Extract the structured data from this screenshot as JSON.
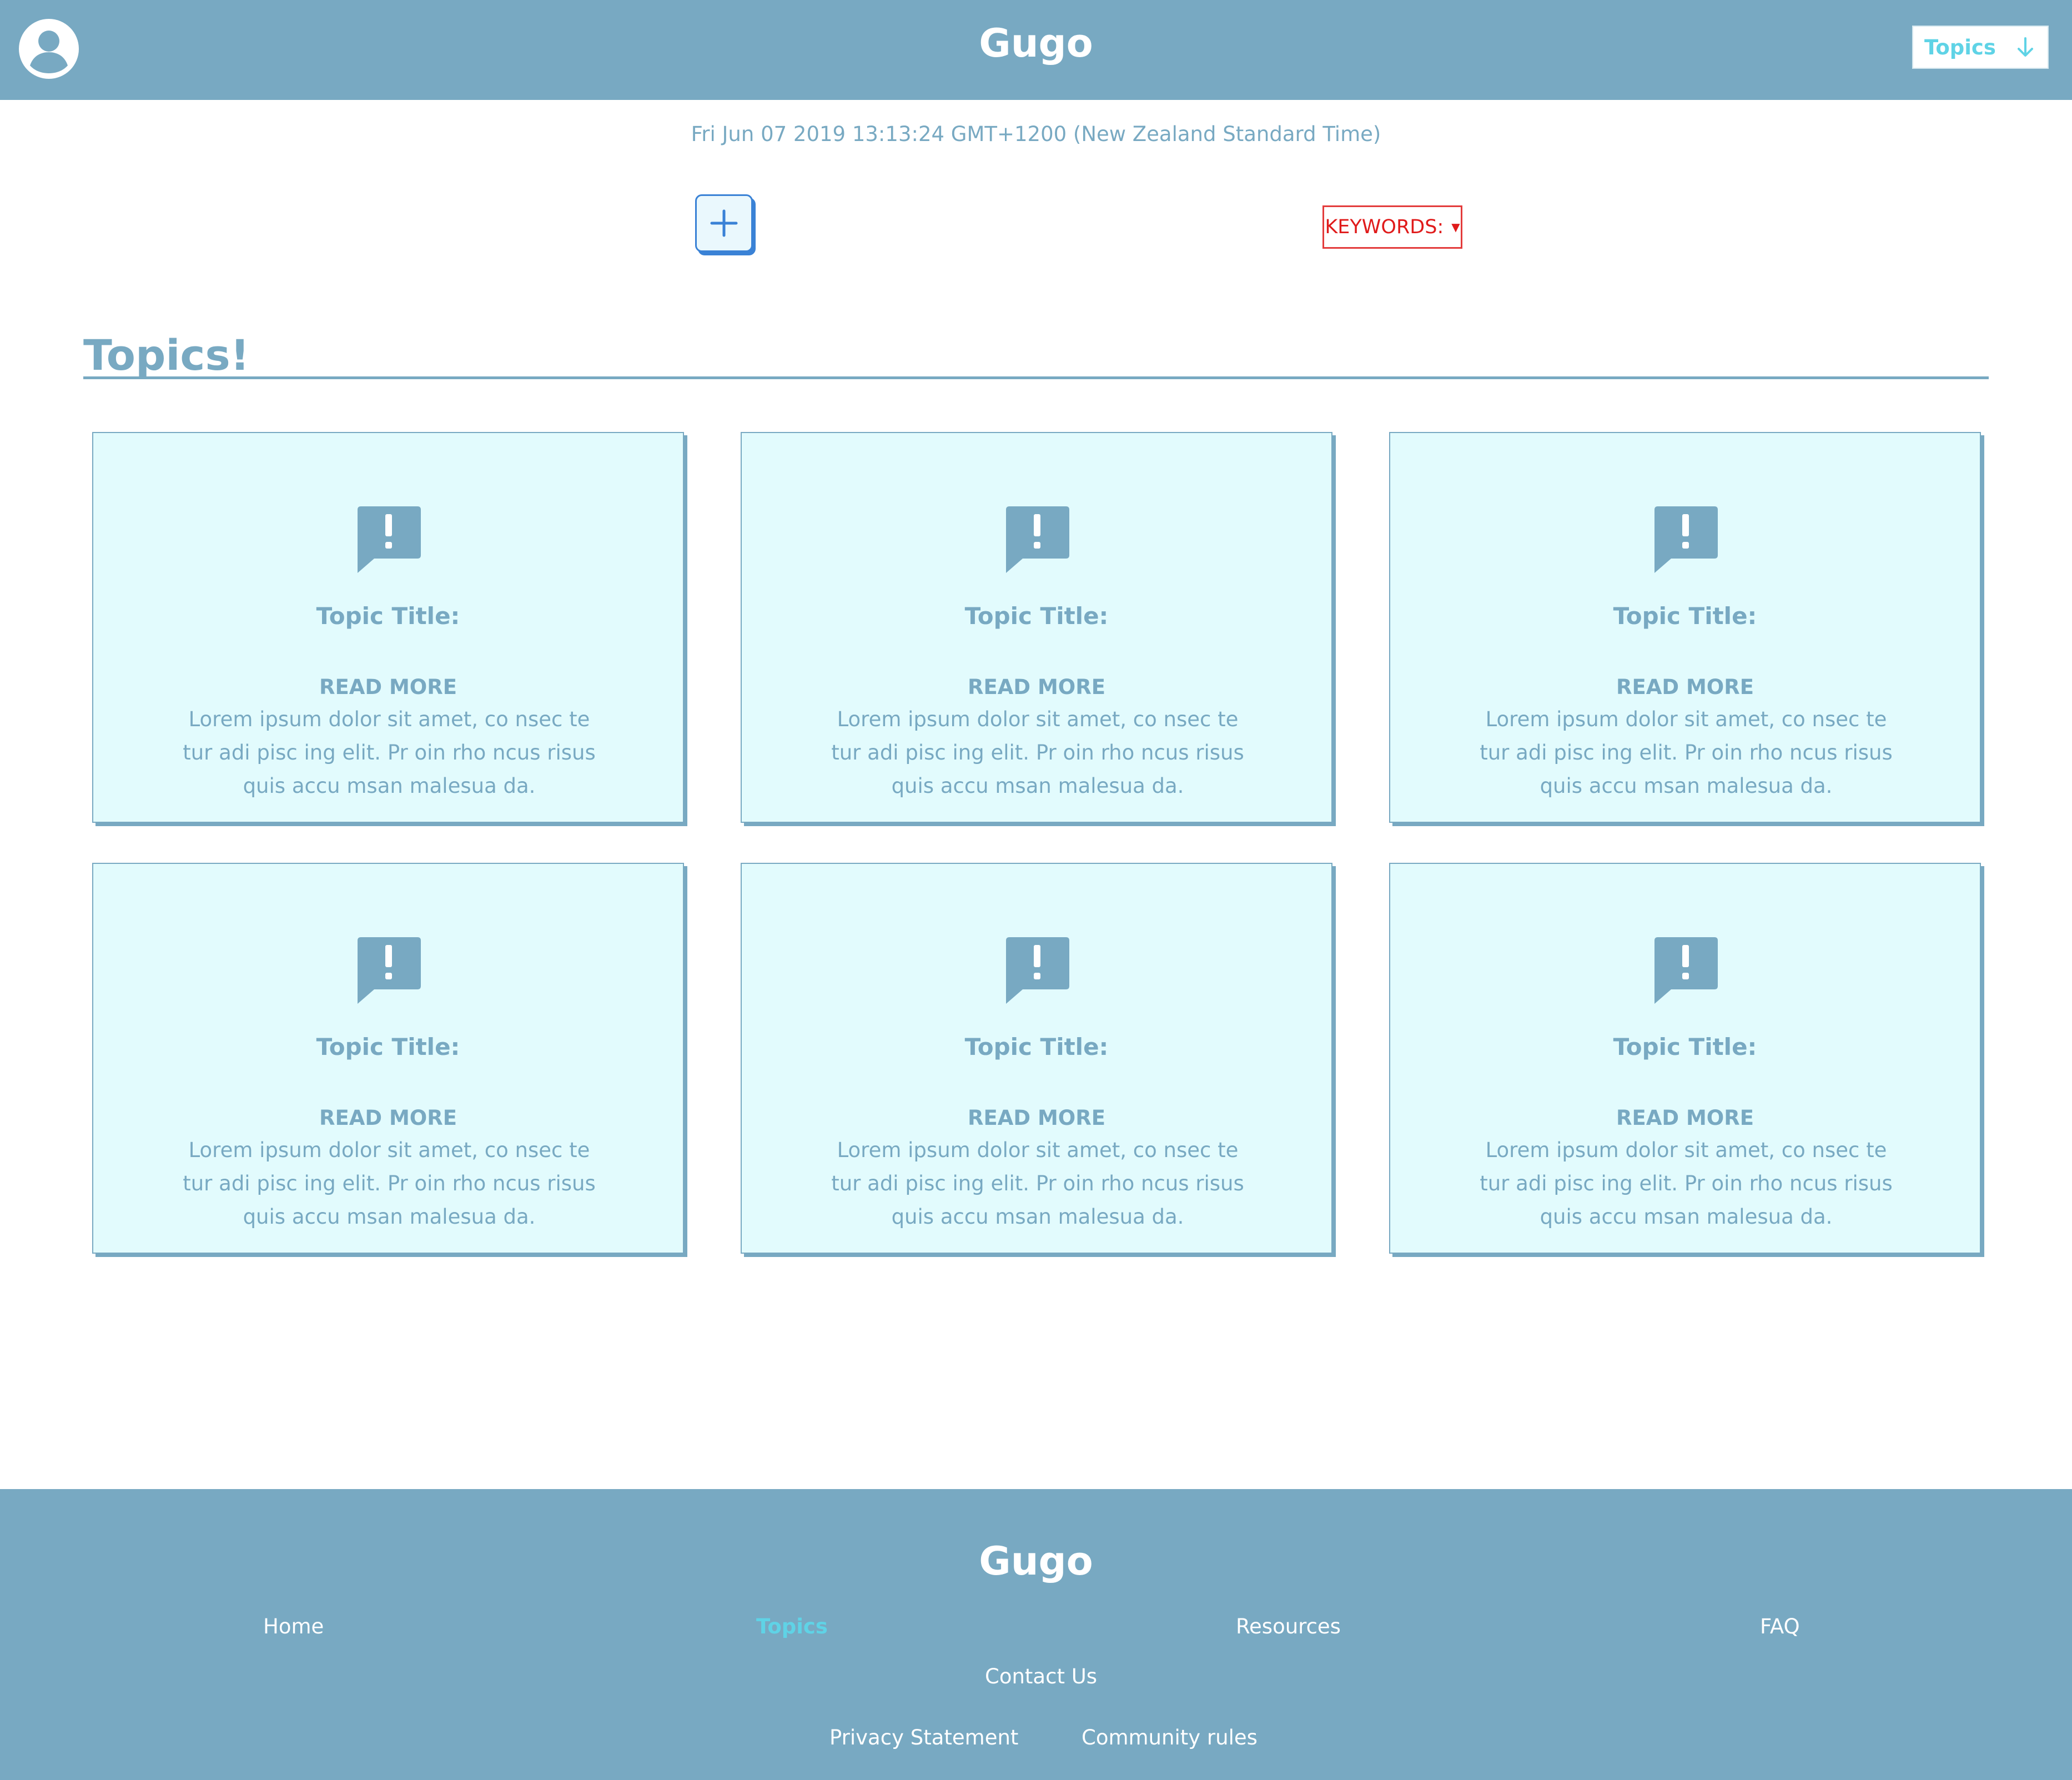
{
  "header": {
    "brand": "Gugo",
    "topics_select": {
      "label": "Topics"
    }
  },
  "date_text": "Fri Jun 07 2019 13:13:24 GMT+1200 (New Zealand Standard Time)",
  "controls": {
    "add_label": "+",
    "keywords_label": "KEYWORDS:",
    "keywords_caret": "▼"
  },
  "section": {
    "title": "Topics!"
  },
  "cards": [
    {
      "title": "Topic Title:",
      "read_more": "READ MORE",
      "body": "Lorem ipsum dolor sit amet, co nsec te tur adi pisc ing elit. Pr oin rho ncus risus quis accu msan malesua da."
    },
    {
      "title": "Topic Title:",
      "read_more": "READ MORE",
      "body": "Lorem ipsum dolor sit amet, co nsec te tur adi pisc ing elit. Pr oin rho ncus risus quis accu msan malesua da."
    },
    {
      "title": "Topic Title:",
      "read_more": "READ MORE",
      "body": "Lorem ipsum dolor sit amet, co nsec te tur adi pisc ing elit. Pr oin rho ncus risus quis accu msan malesua da."
    },
    {
      "title": "Topic Title:",
      "read_more": "READ MORE",
      "body": "Lorem ipsum dolor sit amet, co nsec te tur adi pisc ing elit. Pr oin rho ncus risus quis accu msan malesua da."
    },
    {
      "title": "Topic Title:",
      "read_more": "READ MORE",
      "body": "Lorem ipsum dolor sit amet, co nsec te tur adi pisc ing elit. Pr oin rho ncus risus quis accu msan malesua da."
    },
    {
      "title": "Topic Title:",
      "read_more": "READ MORE",
      "body": "Lorem ipsum dolor sit amet, co nsec te tur adi pisc ing elit. Pr oin rho ncus risus quis accu msan malesua da."
    }
  ],
  "footer": {
    "brand": "Gugo",
    "links": {
      "home": "Home",
      "topics": "Topics",
      "resources": "Resources",
      "faq": "FAQ",
      "contact": "Contact Us",
      "privacy": "Privacy Statement",
      "community": "Community rules"
    }
  },
  "colors": {
    "primary": "#78a9c2",
    "card_background": "#e2fbfd",
    "accent_cyan": "#5fd3e6",
    "add_button_blue": "#3a82d6",
    "keywords_red": "#e01b1b"
  },
  "icons": {
    "avatar": "user-circle-icon",
    "select_arrow": "arrow-down-icon",
    "card": "alert-message-icon"
  }
}
